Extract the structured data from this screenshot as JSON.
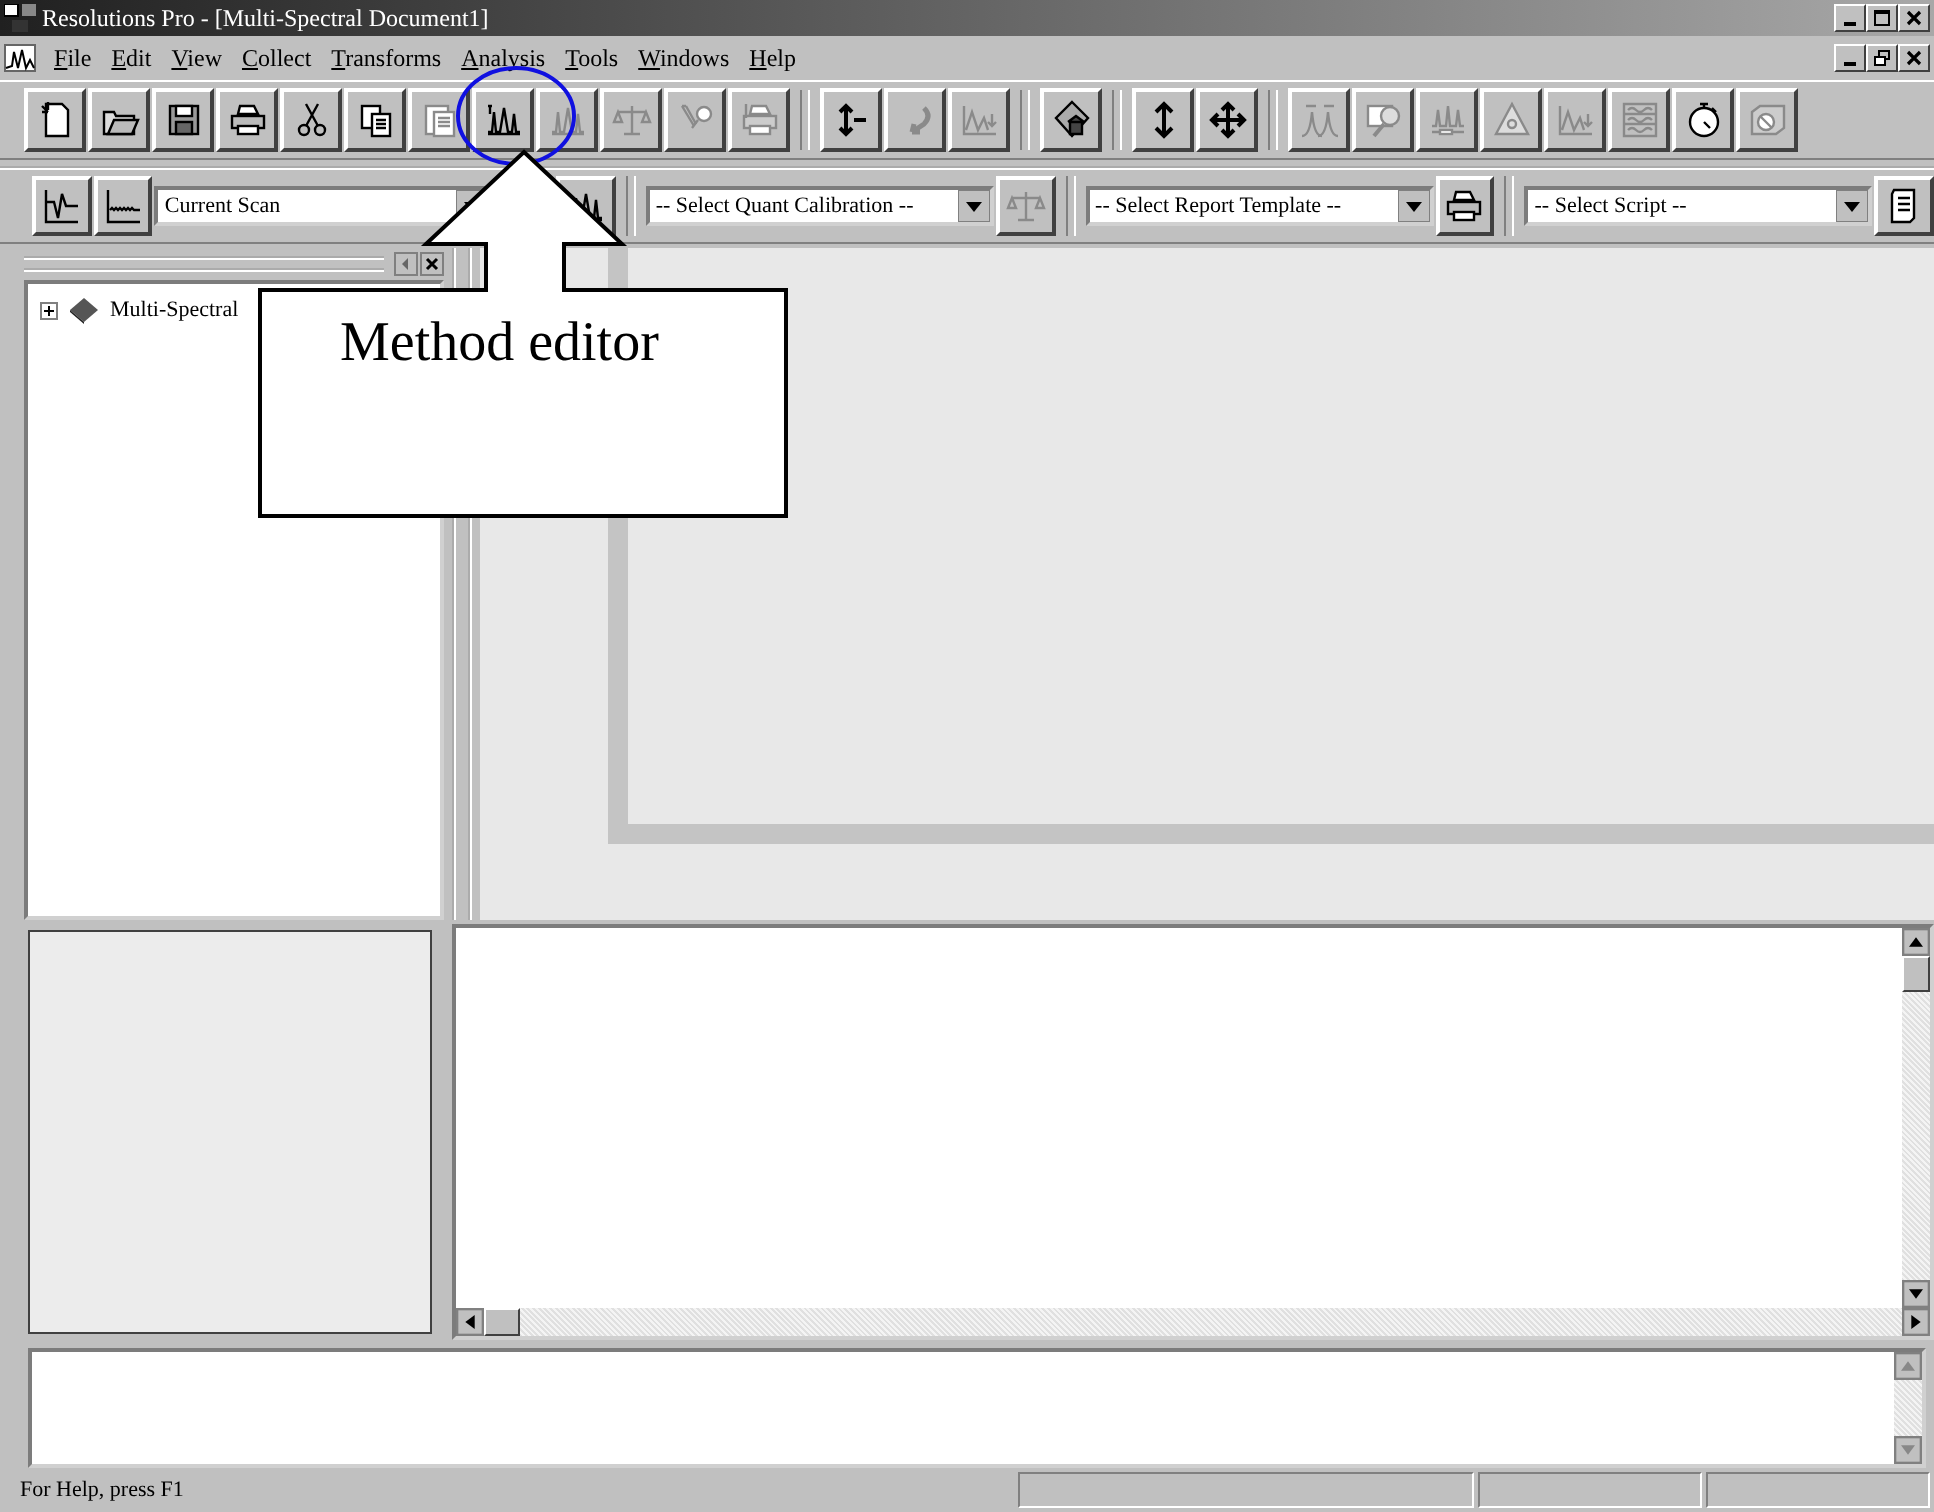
{
  "window": {
    "title": "Resolutions Pro - [Multi-Spectral Document1]"
  },
  "menu": [
    "File",
    "Edit",
    "View",
    "Collect",
    "Transforms",
    "Analysis",
    "Tools",
    "Windows",
    "Help"
  ],
  "toolbar": [
    [
      {
        "kind": "new",
        "disabled": false
      },
      {
        "kind": "open",
        "disabled": false
      },
      {
        "kind": "save",
        "disabled": false
      },
      {
        "kind": "print",
        "disabled": false
      },
      {
        "kind": "cut",
        "disabled": false
      },
      {
        "kind": "copy",
        "disabled": false
      },
      {
        "kind": "paste",
        "disabled": true
      },
      {
        "kind": "method",
        "disabled": false
      },
      {
        "kind": "spectrum",
        "disabled": true
      },
      {
        "kind": "balance",
        "disabled": true
      },
      {
        "kind": "wrench",
        "disabled": true
      },
      {
        "kind": "printwrench",
        "disabled": true
      }
    ],
    [
      {
        "kind": "scaley",
        "disabled": false
      },
      {
        "kind": "undo",
        "disabled": true
      },
      {
        "kind": "chart",
        "disabled": true
      }
    ],
    [
      {
        "kind": "map",
        "disabled": false
      }
    ],
    [
      {
        "kind": "updown",
        "disabled": false
      },
      {
        "kind": "move",
        "disabled": false
      }
    ],
    [
      {
        "kind": "curves",
        "disabled": true
      },
      {
        "kind": "magnifier",
        "disabled": true
      },
      {
        "kind": "peakbar",
        "disabled": true
      },
      {
        "kind": "triangle",
        "disabled": true
      },
      {
        "kind": "chart",
        "disabled": true
      },
      {
        "kind": "waves",
        "disabled": true
      },
      {
        "kind": "stopwatch",
        "disabled": false
      },
      {
        "kind": "camera",
        "disabled": true
      }
    ]
  ],
  "toolbar2": [
    [
      {
        "kind": "trace",
        "disabled": false
      },
      {
        "kind": "baseline",
        "disabled": false
      },
      {
        "kind": "combo",
        "value": "Current Scan"
      },
      {
        "kind": "spacer"
      },
      {
        "kind": "spectrum",
        "disabled": false
      }
    ],
    [
      {
        "kind": "combo",
        "value": "-- Select Quant Calibration --"
      },
      {
        "kind": "balance",
        "disabled": true
      }
    ],
    [
      {
        "kind": "combo",
        "value": "-- Select Report Template --"
      },
      {
        "kind": "print",
        "disabled": false
      }
    ],
    [
      {
        "kind": "combo",
        "value": "-- Select Script --"
      },
      {
        "kind": "scroll",
        "disabled": false
      }
    ]
  ],
  "tree": [
    {
      "label": "Multi-Spectral",
      "expanded": false
    }
  ],
  "callout": {
    "text": "Method editor"
  },
  "status_bar": {
    "text": "For Help, press F1"
  }
}
